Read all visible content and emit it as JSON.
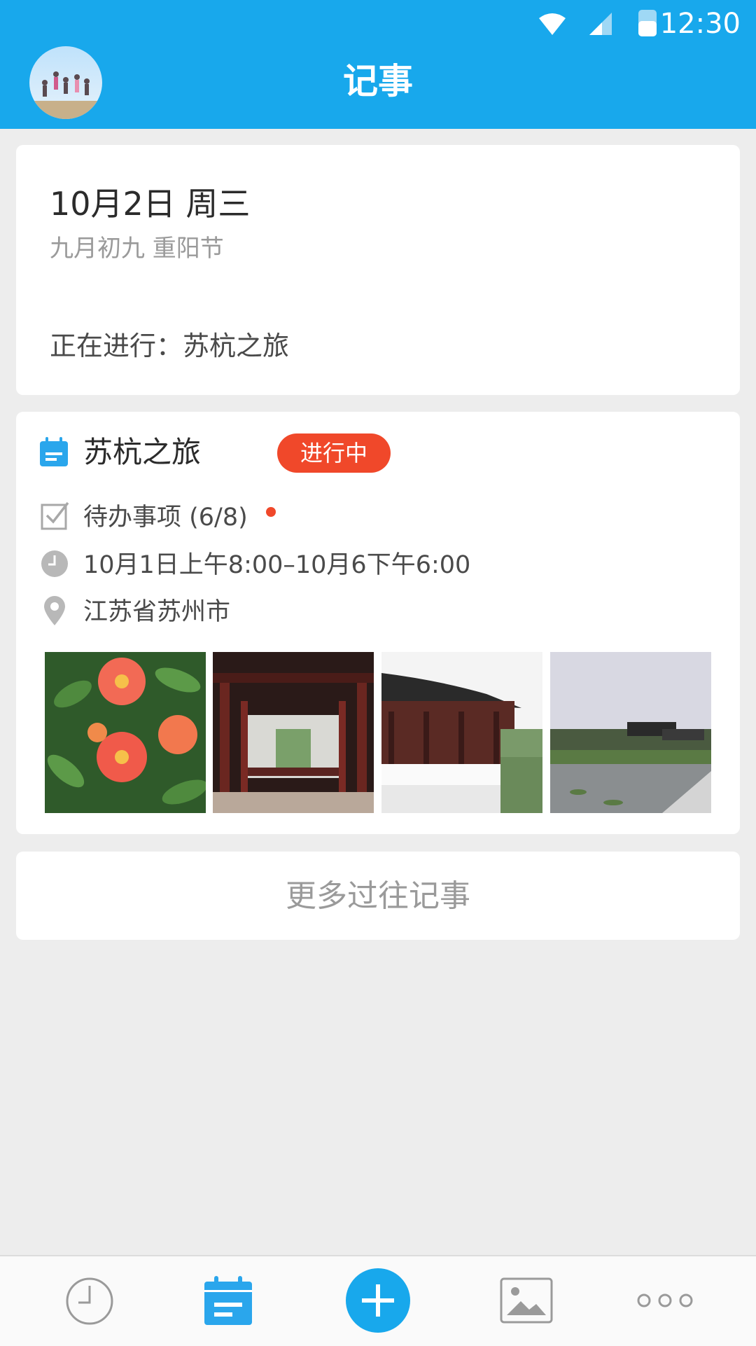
{
  "status_bar": {
    "time": "12:30"
  },
  "header": {
    "title": "记事"
  },
  "today": {
    "date": "10月2日 周三",
    "lunar": "九月初九 重阳节",
    "ongoing": "正在进行：苏杭之旅"
  },
  "event": {
    "title": "苏杭之旅",
    "badge": "进行中",
    "todo": "待办事项 (6/8)",
    "time": "10月1日上午8:00–10月6下午6:00",
    "location": "江苏省苏州市",
    "photos": [
      "flowers-photo",
      "corridor-photo",
      "pavilion-photo",
      "lake-photo"
    ]
  },
  "more": {
    "label": "更多过往记事"
  },
  "colors": {
    "accent": "#18a8ec",
    "badge": "#f0482a"
  },
  "bottom_nav": [
    "clock-icon",
    "calendar-icon",
    "add-icon",
    "image-icon",
    "more-icon"
  ]
}
